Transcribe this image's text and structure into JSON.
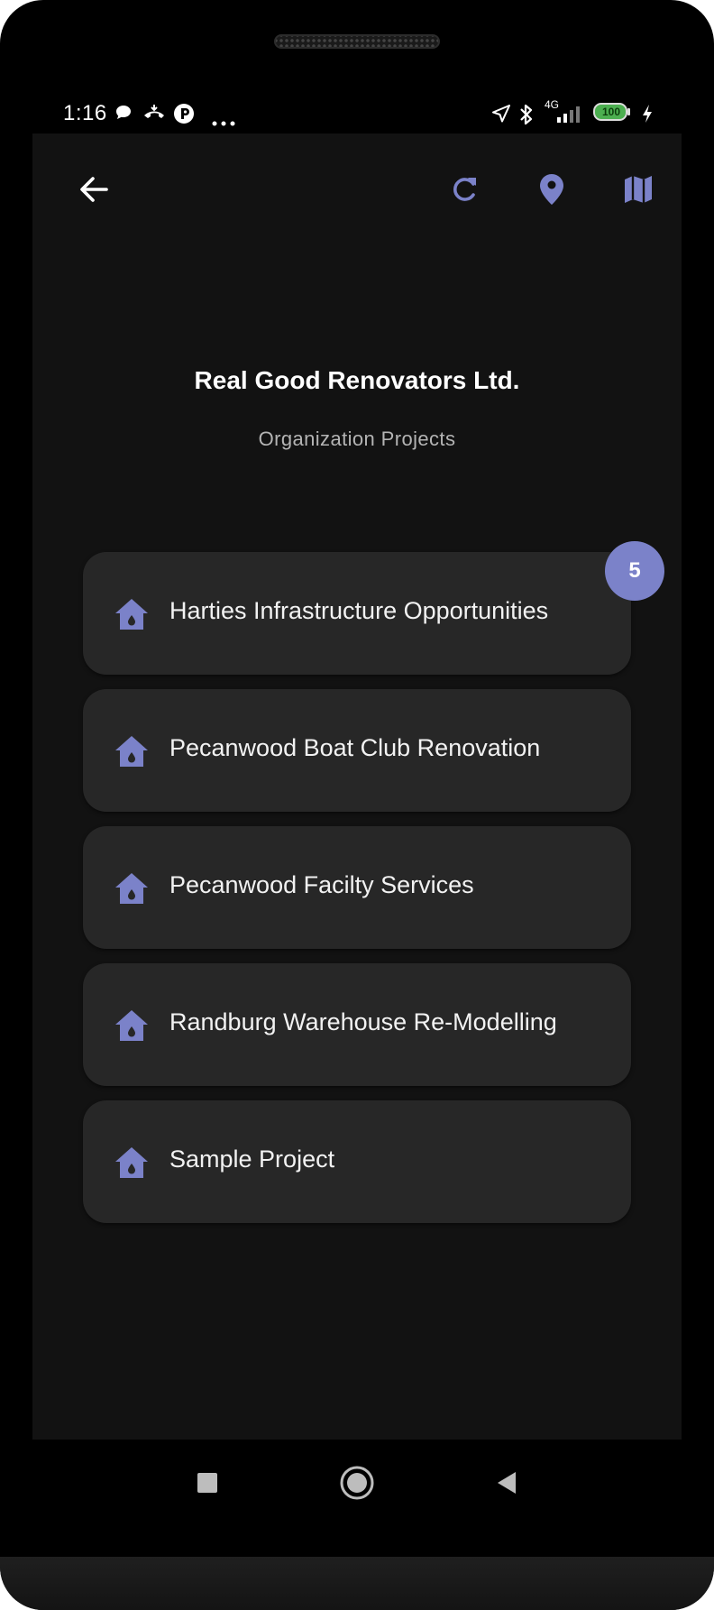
{
  "status_bar": {
    "time": "1:16",
    "network": "4G",
    "battery": "100",
    "icons": [
      "chat-bubble-icon",
      "call-forwarding-icon",
      "app-notification-icon",
      "more-dots-icon",
      "location-arrow-icon",
      "bluetooth-icon",
      "signal-icon",
      "battery-icon",
      "charging-icon"
    ]
  },
  "toolbar": {
    "icons": [
      "back-arrow-icon",
      "refresh-icon",
      "location-pin-icon",
      "map-icon"
    ]
  },
  "header": {
    "title": "Real Good Renovators Ltd.",
    "subtitle": "Organization Projects"
  },
  "projects": [
    {
      "name": "Harties Infrastructure Opportunities",
      "icon": "project-house-icon"
    },
    {
      "name": "Pecanwood Boat Club Renovation",
      "icon": "project-house-icon"
    },
    {
      "name": "Pecanwood Facilty Services",
      "icon": "project-house-icon"
    },
    {
      "name": "Randburg Warehouse Re-Modelling",
      "icon": "project-house-icon"
    },
    {
      "name": "Sample Project",
      "icon": "project-house-icon"
    }
  ],
  "project_count": "5",
  "colors": {
    "accent": "#7b82c9",
    "screen_background": "#121212",
    "card_background": "#272727",
    "battery": "#4caf50"
  }
}
